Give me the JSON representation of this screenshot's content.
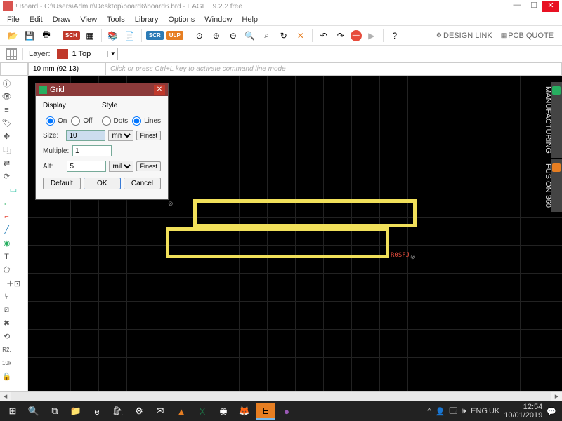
{
  "title": "! Board - C:\\Users\\Admin\\Desktop\\board6\\board6.brd - EAGLE 9.2.2 free",
  "menu": [
    "File",
    "Edit",
    "Draw",
    "View",
    "Tools",
    "Library",
    "Options",
    "Window",
    "Help"
  ],
  "toolbar": {
    "badges": {
      "sch": "SCH",
      "scr": "SCR",
      "ulp": "ULP"
    },
    "links": {
      "design": "DESIGN LINK",
      "pcb": "PCB QUOTE"
    }
  },
  "layer": {
    "label": "Layer:",
    "value": "1 Top"
  },
  "coord": {
    "value": "10 mm (92 13)",
    "cmd_placeholder": "Click or press Ctrl+L key to activate command line mode"
  },
  "sidetabs": {
    "manuf": "MANUFACTURING",
    "fusion": "FUSION 360"
  },
  "canvas": {
    "ref": "R0SFJ"
  },
  "grid_dialog": {
    "title": "Grid",
    "display": "Display",
    "style": "Style",
    "on": "On",
    "off": "Off",
    "dots": "Dots",
    "lines": "Lines",
    "size": "Size:",
    "size_val": "10",
    "size_unit": "mm",
    "finest": "Finest",
    "multiple": "Multiple:",
    "multiple_val": "1",
    "alt": "Alt:",
    "alt_val": "5",
    "alt_unit": "mil",
    "default": "Default",
    "ok": "OK",
    "cancel": "Cancel"
  },
  "tray": {
    "lang": "ENG",
    "kb": "UK",
    "time": "12:54",
    "date": "10/01/2019"
  }
}
